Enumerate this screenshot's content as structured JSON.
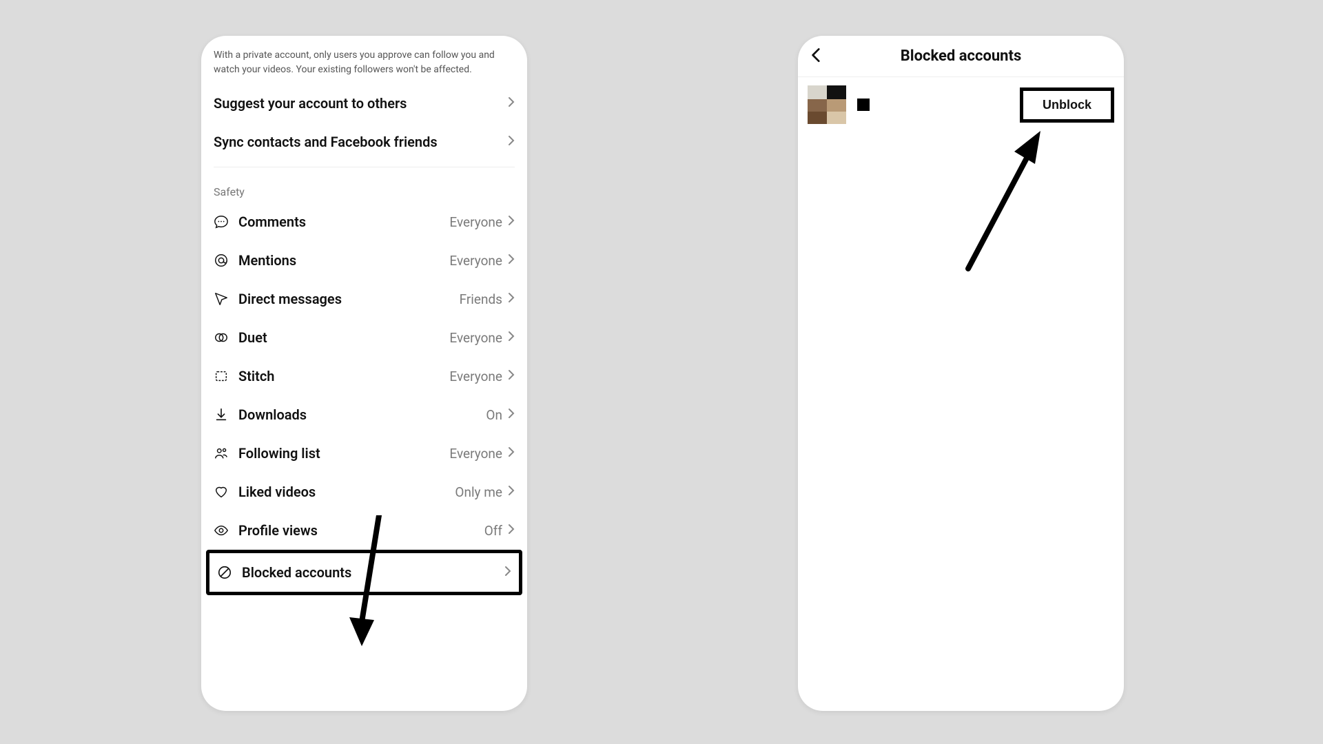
{
  "left": {
    "description": "With a private account, only users you approve can follow you and watch your videos. Your existing followers won't be affected.",
    "suggest": "Suggest your account to others",
    "sync": "Sync contacts and Facebook friends",
    "safety_header": "Safety",
    "items": [
      {
        "label": "Comments",
        "value": "Everyone"
      },
      {
        "label": "Mentions",
        "value": "Everyone"
      },
      {
        "label": "Direct messages",
        "value": "Friends"
      },
      {
        "label": "Duet",
        "value": "Everyone"
      },
      {
        "label": "Stitch",
        "value": "Everyone"
      },
      {
        "label": "Downloads",
        "value": "On"
      },
      {
        "label": "Following list",
        "value": "Everyone"
      },
      {
        "label": "Liked videos",
        "value": "Only me"
      },
      {
        "label": "Profile views",
        "value": "Off"
      },
      {
        "label": "Blocked accounts",
        "value": ""
      }
    ]
  },
  "right": {
    "title": "Blocked accounts",
    "unblock": "Unblock"
  }
}
